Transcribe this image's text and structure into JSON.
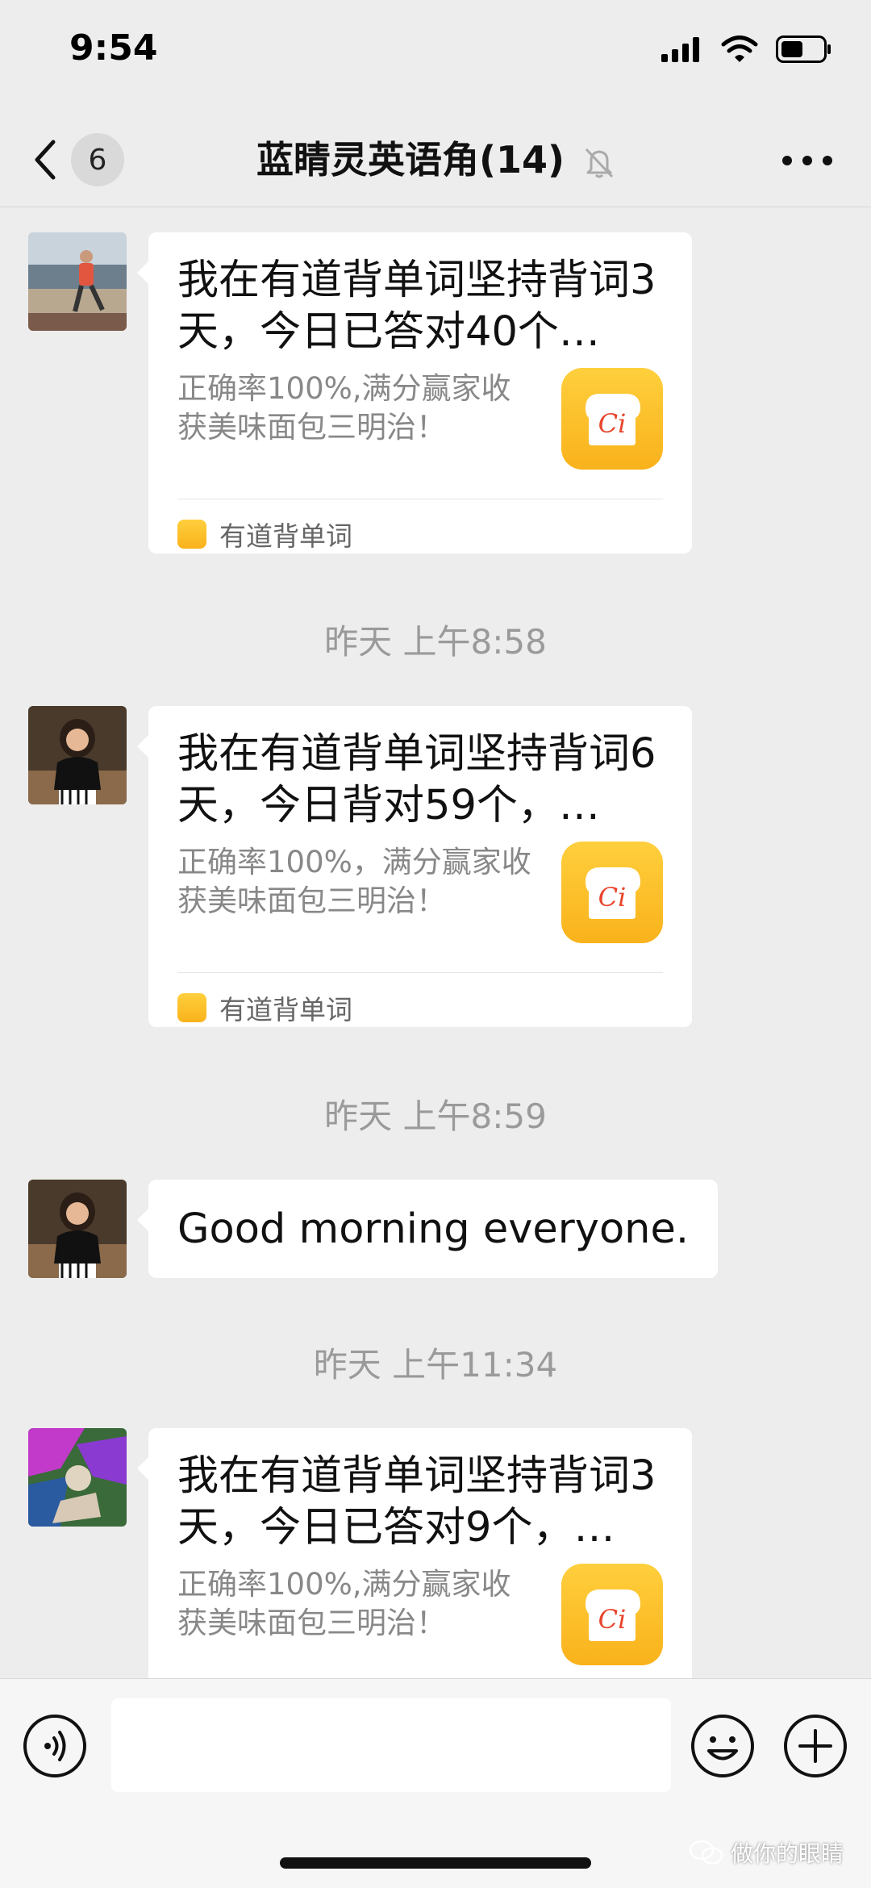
{
  "status_bar": {
    "time": "9:54"
  },
  "nav": {
    "back_count": "6",
    "title": "蓝睛灵英语角(14)"
  },
  "messages": [
    {
      "type": "card",
      "title": "我在有道背单词坚持背词3天，今日已答对40个…",
      "desc": "正确率100%,满分赢家收获美味面包三明治！",
      "source": "有道背单词",
      "icon_text": "Ci"
    },
    {
      "type": "timestamp",
      "text": "昨天 上午8:58"
    },
    {
      "type": "card",
      "title": "我在有道背单词坚持背词6天，今日背对59个，…",
      "desc": "正确率100%，满分赢家收获美味面包三明治！",
      "source": "有道背单词",
      "icon_text": "Ci"
    },
    {
      "type": "timestamp",
      "text": "昨天 上午8:59"
    },
    {
      "type": "text",
      "text": "Good morning everyone."
    },
    {
      "type": "timestamp",
      "text": "昨天 上午11:34"
    },
    {
      "type": "card",
      "title": "我在有道背单词坚持背词3天，今日已答对9个，…",
      "desc": "正确率100%,满分赢家收获美味面包三明治！",
      "icon_text": "Ci"
    }
  ],
  "input": {
    "placeholder": ""
  },
  "watermark": "做你的眼睛",
  "colors": {
    "background": "#ededed",
    "bubble": "#ffffff",
    "app_icon": "#f9b21b",
    "timestamp": "#9a9a9a"
  }
}
